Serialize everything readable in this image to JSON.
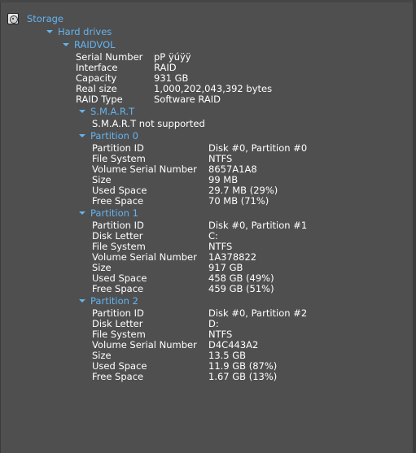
{
  "tree": {
    "root": "Storage",
    "hard_drives": "Hard drives",
    "drive": {
      "name": "RAIDVOL",
      "properties": [
        {
          "key": "Serial Number",
          "value": "pP ÿúÿÿ"
        },
        {
          "key": "Interface",
          "value": "RAID"
        },
        {
          "key": "Capacity",
          "value": "931 GB"
        },
        {
          "key": "Real size",
          "value": "1,000,202,043,392 bytes"
        },
        {
          "key": "RAID Type",
          "value": "Software RAID"
        }
      ],
      "smart": {
        "label": "S.M.A.R.T",
        "status": "S.M.A.R.T not supported"
      },
      "partitions": [
        {
          "label": "Partition 0",
          "properties": [
            {
              "key": "Partition ID",
              "value": "Disk #0, Partition #0"
            },
            {
              "key": "File System",
              "value": "NTFS"
            },
            {
              "key": "Volume Serial Number",
              "value": "8657A1A8"
            },
            {
              "key": "Size",
              "value": "99 MB"
            },
            {
              "key": "Used Space",
              "value": "29.7 MB (29%)"
            },
            {
              "key": "Free Space",
              "value": "70 MB (71%)"
            }
          ]
        },
        {
          "label": "Partition 1",
          "properties": [
            {
              "key": "Partition ID",
              "value": "Disk #0, Partition #1"
            },
            {
              "key": "Disk Letter",
              "value": "C:"
            },
            {
              "key": "File System",
              "value": "NTFS"
            },
            {
              "key": "Volume Serial Number",
              "value": "1A378822"
            },
            {
              "key": "Size",
              "value": "917 GB"
            },
            {
              "key": "Used Space",
              "value": "458 GB (49%)"
            },
            {
              "key": "Free Space",
              "value": "459 GB (51%)"
            }
          ]
        },
        {
          "label": "Partition 2",
          "properties": [
            {
              "key": "Partition ID",
              "value": "Disk #0, Partition #2"
            },
            {
              "key": "Disk Letter",
              "value": "D:"
            },
            {
              "key": "File System",
              "value": "NTFS"
            },
            {
              "key": "Volume Serial Number",
              "value": "D4C443A2"
            },
            {
              "key": "Size",
              "value": "13.5 GB"
            },
            {
              "key": "Used Space",
              "value": "11.9 GB (87%)"
            },
            {
              "key": "Free Space",
              "value": "1.67 GB (13%)"
            }
          ]
        }
      ]
    }
  },
  "colors": {
    "background": "#4f4f4f",
    "node_text": "#64b4f0",
    "value_text": "#ffffff"
  },
  "icons": {
    "root": "hard-disk-icon",
    "expander": "triangle-down-icon"
  }
}
